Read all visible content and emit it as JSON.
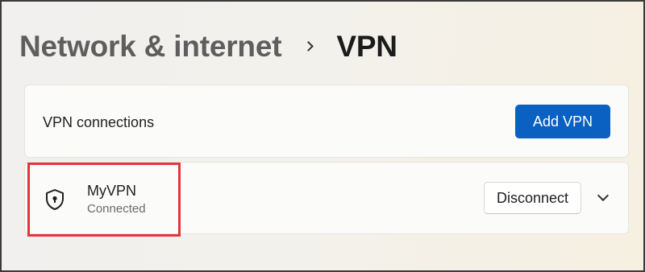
{
  "breadcrumb": {
    "parent": "Network & internet",
    "current": "VPN"
  },
  "connections_card": {
    "label": "VPN connections",
    "add_button_label": "Add VPN"
  },
  "vpn_item": {
    "name": "MyVPN",
    "status": "Connected",
    "icon": "shield-lock-icon",
    "disconnect_label": "Disconnect",
    "expand_icon": "chevron-down-icon"
  },
  "colors": {
    "accent": "#0b61c2",
    "highlight": "#e0383a"
  }
}
